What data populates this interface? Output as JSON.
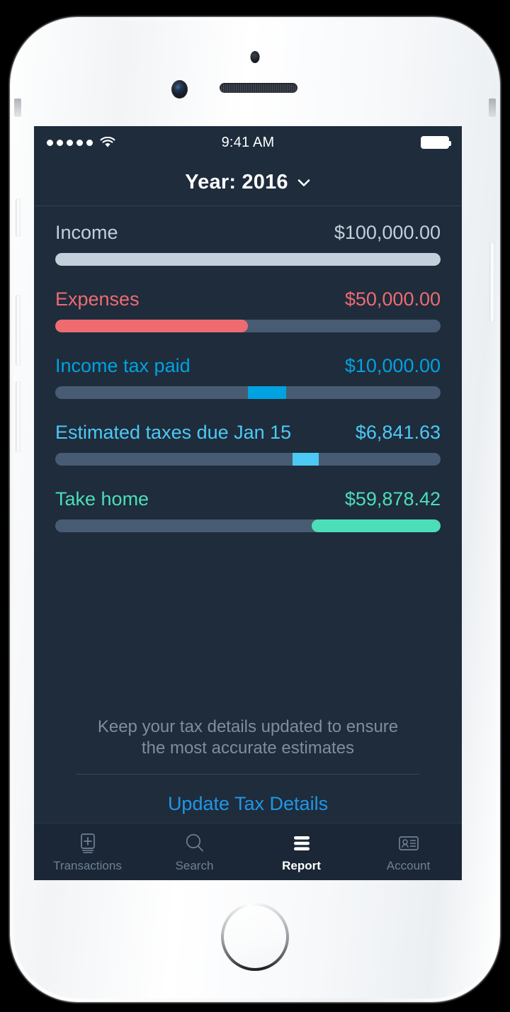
{
  "status_bar": {
    "signal_dots": 5,
    "wifi_icon": "wifi-icon",
    "time": "9:41 AM",
    "battery_icon": "battery-full-icon"
  },
  "header": {
    "title": "Year: 2016",
    "chevron_icon": "chevron-down-icon"
  },
  "colors": {
    "screen_bg": "#1e2c3c",
    "track": "#475c72",
    "income": "#c3cfdb",
    "expenses": "#ee6b70",
    "income_tax_paid": "#00a2e0",
    "estimated_taxes": "#4cc9f5",
    "take_home": "#4cdeb8",
    "link": "#2196e6",
    "muted_text": "#7f8d9c"
  },
  "chart_data": {
    "type": "bar",
    "title": "Year: 2016",
    "categories": [
      "Income",
      "Expenses",
      "Income tax paid",
      "Estimated taxes due Jan 15",
      "Take home"
    ],
    "values": [
      100000.0,
      50000.0,
      10000.0,
      6841.63,
      59878.42
    ],
    "value_labels": [
      "$100,000.00",
      "$50,000.00",
      "$10,000.00",
      "$6,841.63",
      "$59,878.42"
    ],
    "xlabel": "",
    "ylabel": "",
    "ylim": [
      0,
      100000
    ],
    "grid": false,
    "legend": "none"
  },
  "rows": [
    {
      "label": "Income",
      "value": "$100,000.00",
      "color": "#c3cfdb",
      "seg_start_pct": 0,
      "seg_end_pct": 100,
      "rounded": true
    },
    {
      "label": "Expenses",
      "value": "$50,000.00",
      "color": "#ee6b70",
      "seg_start_pct": 0,
      "seg_end_pct": 50,
      "rounded": true
    },
    {
      "label": "Income tax paid",
      "value": "$10,000.00",
      "color": "#00a2e0",
      "seg_start_pct": 50,
      "seg_end_pct": 60,
      "rounded": false
    },
    {
      "label": "Estimated taxes due Jan 15",
      "value": "$6,841.63",
      "color": "#4cc9f5",
      "seg_start_pct": 61.6,
      "seg_end_pct": 68.4,
      "rounded": false
    },
    {
      "label": "Take home",
      "value": "$59,878.42",
      "color": "#4cdeb8",
      "seg_start_pct": 66.5,
      "seg_end_pct": 100,
      "rounded": true
    }
  ],
  "footer": {
    "note_line1": "Keep your tax details updated to ensure",
    "note_line2": "the most accurate estimates",
    "update_link": "Update Tax Details"
  },
  "tabs": [
    {
      "label": "Transactions",
      "icon": "book-plus-icon",
      "active": false
    },
    {
      "label": "Search",
      "icon": "search-icon",
      "active": false
    },
    {
      "label": "Report",
      "icon": "report-bars-icon",
      "active": true
    },
    {
      "label": "Account",
      "icon": "id-card-icon",
      "active": false
    }
  ]
}
